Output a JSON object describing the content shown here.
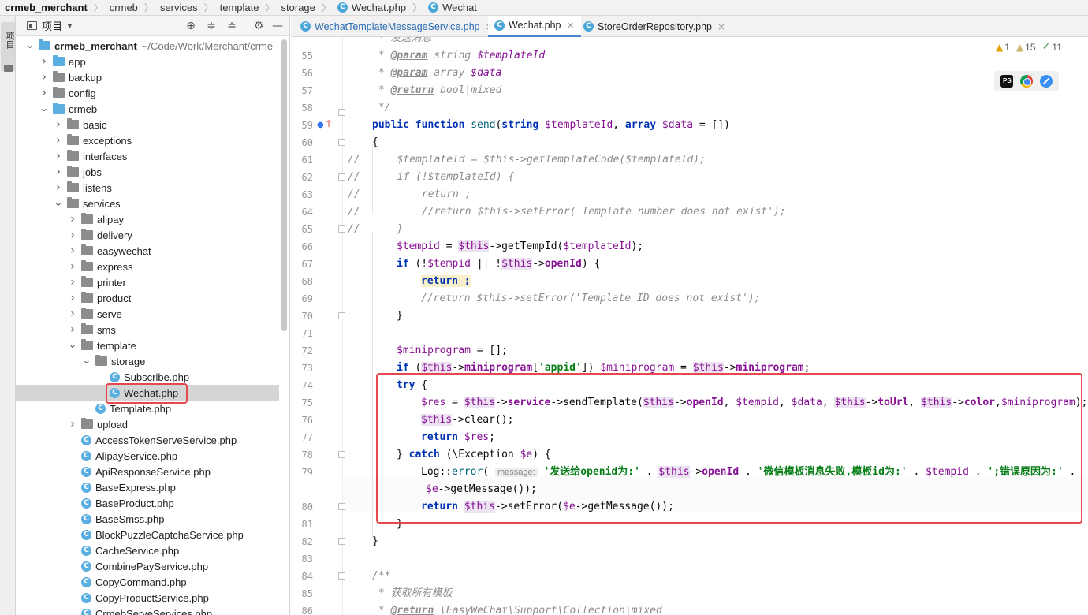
{
  "breadcrumb": [
    {
      "label": "crmeb_merchant",
      "bold": true
    },
    {
      "label": "crmeb"
    },
    {
      "label": "services"
    },
    {
      "label": "template"
    },
    {
      "label": "storage"
    },
    {
      "label": "Wechat.php",
      "icon": "class-icon"
    },
    {
      "label": "Wechat",
      "icon": "class-icon"
    }
  ],
  "sidestripe": {
    "label": "项目"
  },
  "project": {
    "title": "项目"
  },
  "tree": [
    {
      "label": "crmeb_merchant",
      "path": "~/Code/Work/Merchant/crme",
      "depth": 0,
      "arrow": "down",
      "kind": "folder-blue",
      "root": true
    },
    {
      "label": "app",
      "depth": 1,
      "arrow": "right",
      "kind": "folder-blue"
    },
    {
      "label": "backup",
      "depth": 1,
      "arrow": "right",
      "kind": "folder"
    },
    {
      "label": "config",
      "depth": 1,
      "arrow": "right",
      "kind": "folder"
    },
    {
      "label": "crmeb",
      "depth": 1,
      "arrow": "down",
      "kind": "folder-blue"
    },
    {
      "label": "basic",
      "depth": 2,
      "arrow": "right",
      "kind": "folder"
    },
    {
      "label": "exceptions",
      "depth": 2,
      "arrow": "right",
      "kind": "folder"
    },
    {
      "label": "interfaces",
      "depth": 2,
      "arrow": "right",
      "kind": "folder"
    },
    {
      "label": "jobs",
      "depth": 2,
      "arrow": "right",
      "kind": "folder"
    },
    {
      "label": "listens",
      "depth": 2,
      "arrow": "right",
      "kind": "folder"
    },
    {
      "label": "services",
      "depth": 2,
      "arrow": "down",
      "kind": "folder"
    },
    {
      "label": "alipay",
      "depth": 3,
      "arrow": "right",
      "kind": "folder"
    },
    {
      "label": "delivery",
      "depth": 3,
      "arrow": "right",
      "kind": "folder"
    },
    {
      "label": "easywechat",
      "depth": 3,
      "arrow": "right",
      "kind": "folder"
    },
    {
      "label": "express",
      "depth": 3,
      "arrow": "right",
      "kind": "folder"
    },
    {
      "label": "printer",
      "depth": 3,
      "arrow": "right",
      "kind": "folder"
    },
    {
      "label": "product",
      "depth": 3,
      "arrow": "right",
      "kind": "folder"
    },
    {
      "label": "serve",
      "depth": 3,
      "arrow": "right",
      "kind": "folder"
    },
    {
      "label": "sms",
      "depth": 3,
      "arrow": "right",
      "kind": "folder"
    },
    {
      "label": "template",
      "depth": 3,
      "arrow": "down",
      "kind": "folder"
    },
    {
      "label": "storage",
      "depth": 4,
      "arrow": "down",
      "kind": "folder"
    },
    {
      "label": "Subscribe.php",
      "depth": 5,
      "arrow": "",
      "kind": "class"
    },
    {
      "label": "Wechat.php",
      "depth": 5,
      "arrow": "",
      "kind": "class",
      "selected": true
    },
    {
      "label": "Template.php",
      "depth": 4,
      "arrow": "",
      "kind": "class"
    },
    {
      "label": "upload",
      "depth": 3,
      "arrow": "right",
      "kind": "folder"
    },
    {
      "label": "AccessTokenServeService.php",
      "depth": 3,
      "arrow": "",
      "kind": "class"
    },
    {
      "label": "AlipayService.php",
      "depth": 3,
      "arrow": "",
      "kind": "class"
    },
    {
      "label": "ApiResponseService.php",
      "depth": 3,
      "arrow": "",
      "kind": "class"
    },
    {
      "label": "BaseExpress.php",
      "depth": 3,
      "arrow": "",
      "kind": "class"
    },
    {
      "label": "BaseProduct.php",
      "depth": 3,
      "arrow": "",
      "kind": "class"
    },
    {
      "label": "BaseSmss.php",
      "depth": 3,
      "arrow": "",
      "kind": "class"
    },
    {
      "label": "BlockPuzzleCaptchaService.php",
      "depth": 3,
      "arrow": "",
      "kind": "class"
    },
    {
      "label": "CacheService.php",
      "depth": 3,
      "arrow": "",
      "kind": "class"
    },
    {
      "label": "CombinePayService.php",
      "depth": 3,
      "arrow": "",
      "kind": "class"
    },
    {
      "label": "CopyCommand.php",
      "depth": 3,
      "arrow": "",
      "kind": "class"
    },
    {
      "label": "CopyProductService.php",
      "depth": 3,
      "arrow": "",
      "kind": "class"
    },
    {
      "label": "CrmebServeServices.php",
      "depth": 3,
      "arrow": "",
      "kind": "class"
    }
  ],
  "tabs": [
    {
      "label": "WechatTemplateMessageService.php",
      "active": false
    },
    {
      "label": "Wechat.php",
      "active": true
    },
    {
      "label": "StoreOrderRepository.php",
      "active": false
    }
  ],
  "inspections": {
    "errors": "1",
    "warnings": "15",
    "weak": "11"
  },
  "browsers": [
    "phpstorm-icon",
    "chrome-icon",
    "safari-icon"
  ],
  "editor": {
    "line_numbers": [
      "55",
      "56",
      "57",
      "58",
      "59",
      "60",
      "61",
      "62",
      "63",
      "64",
      "65",
      "66",
      "67",
      "68",
      "69",
      "70",
      "71",
      "72",
      "73",
      "74",
      "75",
      "76",
      "77",
      "78",
      "79",
      "",
      "80",
      "81",
      "82",
      "83",
      "84",
      "85",
      "86"
    ],
    "lines": {
      "l54": " * 发送消息",
      "l55a": " * ",
      "l55b": "@param",
      "l55c": " string ",
      "l55d": "$templateId",
      "l56a": " * ",
      "l56b": "@param",
      "l56c": " array ",
      "l56d": "$data",
      "l57a": " * ",
      "l57b": "@return",
      "l57c": " bool",
      "l57d": "|",
      "l57e": "mixed",
      "l58": " */",
      "l59a": "public function ",
      "l59b": "send",
      "l59c": "(",
      "l59d": "string ",
      "l59e": "$templateId",
      "l59f": ", ",
      "l59g": "array ",
      "l59h": "$data",
      "l59i": " = [])",
      "l60": "{",
      "l61": "//      $templateId = $this->getTemplateCode($templateId);",
      "l62": "//      if (!$templateId) {",
      "l63": "//          return ;",
      "l64": "//          //return $this->setError('Template number does not exist');",
      "l65": "//      }",
      "l66a": "$tempid",
      "l66b": " = ",
      "l66c": "$this",
      "l66d": "->getTempId(",
      "l66e": "$templateId",
      "l66f": ");",
      "l67a": "if ",
      "l67b": "(!",
      "l67c": "$tempid",
      "l67d": " || !",
      "l67e": "$this",
      "l67f": "->",
      "l67g": "openId",
      "l67h": ") {",
      "l68": "return ;",
      "l69": "//return $this->setError('Template ID does not exist');",
      "l70": "}",
      "l72a": "$miniprogram",
      "l72b": " = [];",
      "l73a": "if ",
      "l73b": "(",
      "l73c": "$this",
      "l73d": "->",
      "l73e": "miniprogram",
      "l73f": "[",
      "l73g": "'appid'",
      "l73h": "]) ",
      "l73i": "$miniprogram",
      "l73j": " = ",
      "l73k": "$this",
      "l73l": "->",
      "l73m": "miniprogram",
      "l73n": ";",
      "l74a": "try ",
      "l74b": "{",
      "l75a": "$res",
      "l75b": " = ",
      "l75c": "$this",
      "l75d": "->",
      "l75e": "service",
      "l75f": "->sendTemplate(",
      "l75g": "$this",
      "l75h": "->",
      "l75i": "openId",
      "l75j": ", ",
      "l75k": "$tempid",
      "l75l": ", ",
      "l75m": "$data",
      "l75n": ", ",
      "l75o": "$this",
      "l75p": "->",
      "l75q": "toUrl",
      "l75r": ", ",
      "l75s": "$this",
      "l75t": "->",
      "l75u": "color",
      "l75v": ",",
      "l75w": "$miniprogram",
      "l75x": ");",
      "l76a": "$this",
      "l76b": "->clear();",
      "l77a": "return ",
      "l77b": "$res",
      "l77c": ";",
      "l78a": "} ",
      "l78b": "catch ",
      "l78c": "(\\Exception ",
      "l78d": "$e",
      "l78e": ") {",
      "l79a": "Log::",
      "l79b": "error",
      "l79c": "( ",
      "l79d": "message:",
      "l79e": " '发送给openid为:'",
      "l79f": " . ",
      "l79g": "$this",
      "l79h": "->",
      "l79i": "openId",
      "l79j": " . ",
      "l79k": "'微信模板消息失败,模板id为:'",
      "l79l": " . ",
      "l79m": "$tempid",
      "l79n": " . ",
      "l79o": "';错误原因为:'",
      "l79p": " .",
      "l79w1": "$e",
      "l79w2": "->getMessage());",
      "l80a": "return ",
      "l80b": "$this",
      "l80c": "->setError(",
      "l80d": "$e",
      "l80e": "->getMessage());",
      "l81": "}",
      "l82": "}",
      "l84": "/**",
      "l85": " * 获取所有模板",
      "l86a": " * ",
      "l86b": "@return",
      "l86c": " \\EasyWeChat\\Support\\Collection",
      "l86d": "|",
      "l86e": "mixed"
    }
  }
}
